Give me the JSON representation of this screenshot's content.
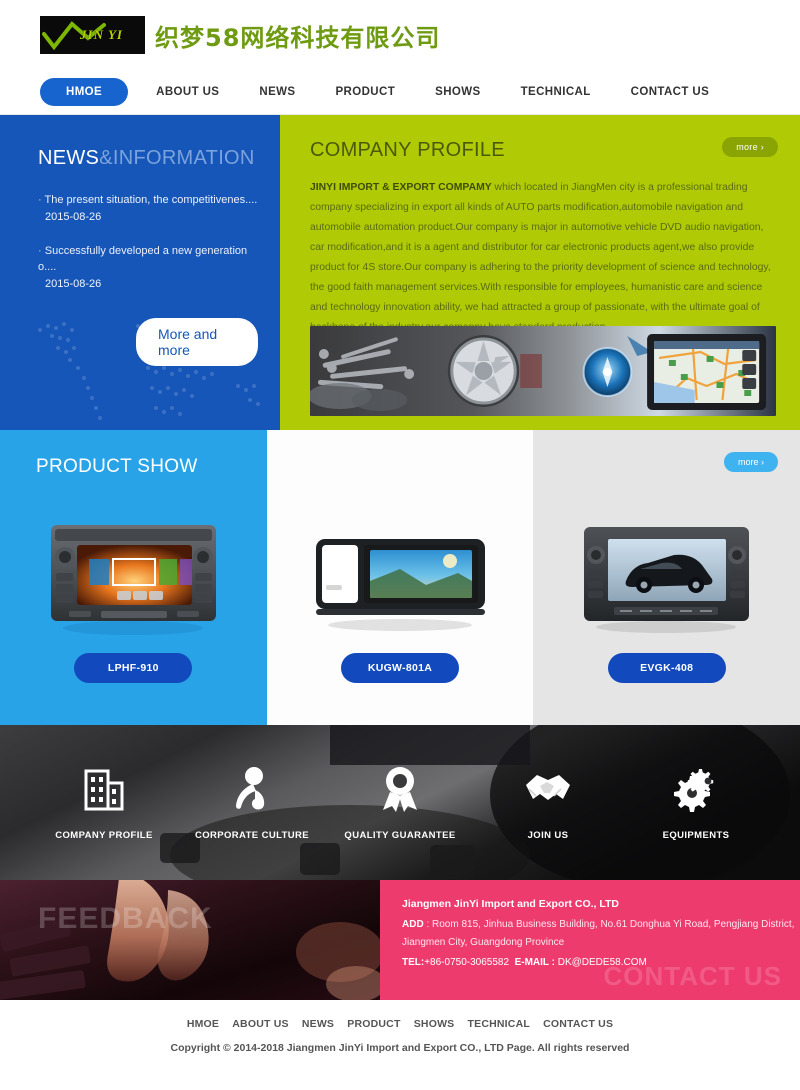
{
  "header": {
    "logo_text": "JIN YI",
    "logo_cn": "织梦58网络科技有限公司"
  },
  "nav": {
    "items": [
      {
        "label": "HMOE",
        "active": true
      },
      {
        "label": "ABOUT US",
        "active": false
      },
      {
        "label": "NEWS",
        "active": false
      },
      {
        "label": "PRODUCT",
        "active": false
      },
      {
        "label": "SHOWS",
        "active": false
      },
      {
        "label": "TECHNICAL",
        "active": false
      },
      {
        "label": "CONTACT US",
        "active": false
      }
    ]
  },
  "news": {
    "title_main": "NEWS",
    "title_sub": "&INFORMATION",
    "items": [
      {
        "title": "The present situation, the competitivenes....",
        "date": "2015-08-26"
      },
      {
        "title": "Successfully developed a new generation o....",
        "date": "2015-08-26"
      }
    ],
    "more_label": "More and more"
  },
  "profile": {
    "title": "COMPANY PROFILE",
    "more_label": "more ›",
    "lead": "JINYI IMPORT & EXPORT COMPAMY",
    "body": " which located in JiangMen city is a professional trading company specializing in export all kinds of AUTO parts modification,automobile navigation and automobile automation product.Our company is major in automotive vehicle DVD audio navigation, car modification,and it is a agent and distributor for car electronic products agent,we also provide product for 4S store.Our company is adhering to the priority development of science and technology, the good faith management services.With responsible for employees, humanistic care and science and technology innovation ability, we had attracted a group of passionate, with the ultimate goal of backbone of the industry,our comapny have standard production ..."
  },
  "product": {
    "title": "PRODUCT SHOW",
    "more_label": "more ›",
    "prev_icon": "chevron-left-icon",
    "next_icon": "chevron-right-icon",
    "items": [
      {
        "name": "LPHF-910"
      },
      {
        "name": "KUGW-801A"
      },
      {
        "name": "EVGK-408"
      }
    ]
  },
  "services": {
    "items": [
      {
        "label": "COMPANY PROFILE",
        "icon": "building-icon"
      },
      {
        "label": "CORPORATE CULTURE",
        "icon": "microphone-person-icon"
      },
      {
        "label": "QUALITY GUARANTEE",
        "icon": "award-ribbon-icon"
      },
      {
        "label": "JOIN US",
        "icon": "handshake-icon"
      },
      {
        "label": "EQUIPMENTS",
        "icon": "gears-icon"
      }
    ]
  },
  "contact": {
    "feedback_word": "FEEDBACK",
    "ghost_word": "CONTACT US",
    "company": "Jiangmen JinYi Import and Export CO., LTD",
    "add_label": "ADD",
    "address": " : Room 815, Jinhua Business Building, No.61 Donghua Yi Road, Pengjiang District, Jiangmen City, Guangdong Province",
    "tel_label": "TEL:",
    "tel": "+86-0750-3065582",
    "email_label": "E-MAIL :",
    "email": "DK@DEDE58.COM"
  },
  "footer": {
    "nav": [
      "HMOE",
      "ABOUT US",
      "NEWS",
      "PRODUCT",
      "SHOWS",
      "TECHNICAL",
      "CONTACT US"
    ],
    "copyright": "Copyright © 2014-2018 Jiangmen JinYi Import and Export CO., LTD   Page. All rights reserved"
  },
  "colors": {
    "nav_active": "#1764ce",
    "news_bg": "#1656b8",
    "profile_bg": "#b0cb05",
    "product_blue": "#29a3e8",
    "product_btn": "#1249bd",
    "contact_pink": "#ee3b6e",
    "logo_green": "#6e9b12"
  }
}
